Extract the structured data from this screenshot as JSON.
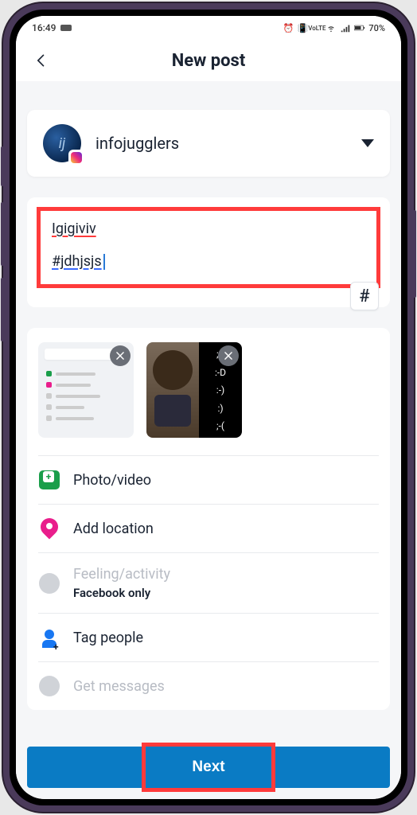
{
  "statusbar": {
    "time": "16:49",
    "battery": "70%"
  },
  "header": {
    "title": "New post"
  },
  "account": {
    "username": "infojugglers",
    "avatar_letter": "ij"
  },
  "caption": {
    "line1": "Igigiviv",
    "hashtag": "#jdhjsjs"
  },
  "hash_button": "#",
  "thumbs": {
    "emoticons": [
      ";-)",
      ":-D",
      ":-)",
      ":)",
      ";-("
    ]
  },
  "options": {
    "photo": "Photo/video",
    "location": "Add location",
    "feeling": "Feeling/activity",
    "feeling_sub": "Facebook only",
    "tag": "Tag people",
    "messages": "Get messages"
  },
  "footer": {
    "next": "Next"
  }
}
